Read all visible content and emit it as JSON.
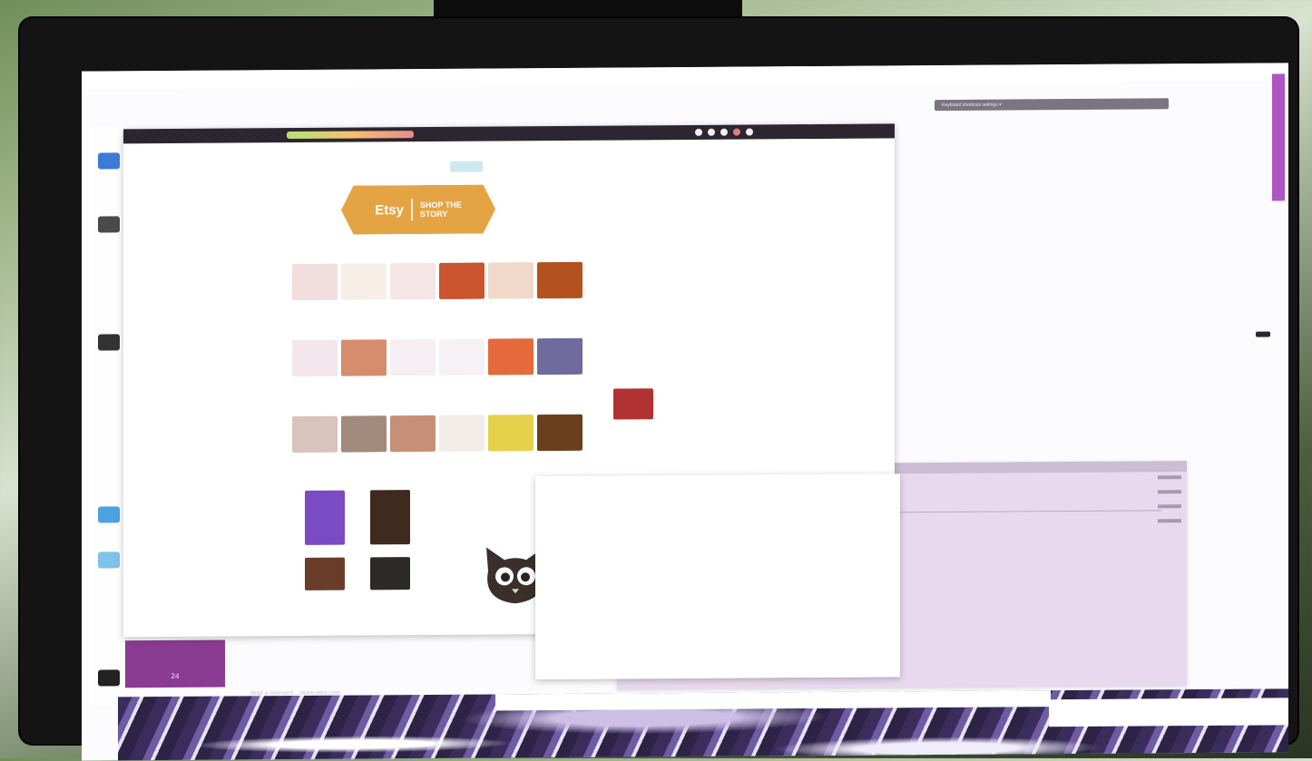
{
  "top_bar": {
    "menu_text": "Keyboard shortcuts settings ▾"
  },
  "browser": {
    "page_tab_label": "",
    "logo": {
      "left_text": "Etsy",
      "right_text": "SHOP THE\nSTORY"
    },
    "thumbnails": [
      {
        "color": "#f1dede"
      },
      {
        "color": "#f7efe7"
      },
      {
        "color": "#f4e6e6"
      },
      {
        "color": "#c9542e"
      },
      {
        "color": "#f0d9c8"
      },
      {
        "color": "#b4521f"
      },
      {
        "color": "#f2e6ec"
      },
      {
        "color": "#d58d6e"
      },
      {
        "color": "#f5eef3"
      },
      {
        "color": "#f6f1f4"
      },
      {
        "color": "#e46a3b"
      },
      {
        "color": "#6f6b9e"
      },
      {
        "color": "#d8c3bd"
      },
      {
        "color": "#a28a7c"
      },
      {
        "color": "#c78f78"
      },
      {
        "color": "#f3ece8"
      },
      {
        "color": "#e6d14a"
      },
      {
        "color": "#6b3f1d"
      }
    ],
    "products": [
      {
        "color": "#7a4bc2"
      },
      {
        "color": "#3e2a1e"
      },
      {
        "color": "#6a3c2a"
      },
      {
        "color": "#2f2a2a"
      }
    ],
    "floating_items": [
      {
        "color": "#b13232"
      },
      {
        "color": "#1f3d73"
      }
    ],
    "avatar_icon": "cat-face-icon",
    "status_text": "Wait a moment... store.etsy.com"
  },
  "side_window": {
    "panel_label": "24"
  },
  "colors": {
    "accent_logo": "#e5a443",
    "toolbar": "#2b2630",
    "launcher_panel": "#8a3b92",
    "scroll_accent": "#ad56c2"
  }
}
